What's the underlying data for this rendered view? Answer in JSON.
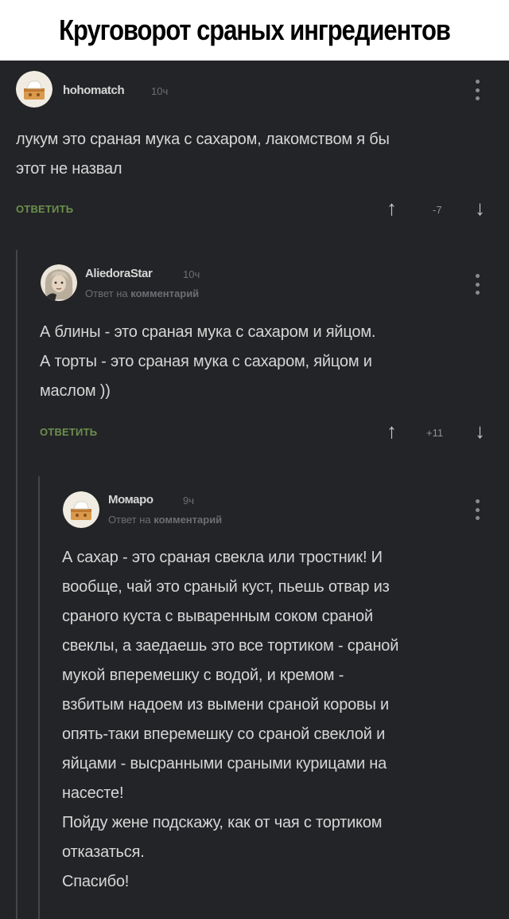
{
  "banner": {
    "title": "Круговорот сраных ингредиентов"
  },
  "comments": [
    {
      "username": "hohomatch",
      "time": "10ч",
      "lines": [
        "лукум это сраная мука с сахаром, лакомством я бы",
        "этот не назвал"
      ],
      "reply_label": "ОТВЕТИТЬ",
      "score": "-7"
    },
    {
      "username": "AliedoraStar",
      "time": "10ч",
      "reply_prefix": "Ответ на",
      "reply_target": "комментарий",
      "lines": [
        "А блины - это сраная мука с сахаром и яйцом.",
        "А торты - это сраная мука с сахаром, яйцом и",
        "маслом ))"
      ],
      "reply_label": "ОТВЕТИТЬ",
      "score": "+11"
    },
    {
      "username": "Момаро",
      "time": "9ч",
      "reply_prefix": "Ответ на",
      "reply_target": "комментарий",
      "lines": [
        "А сахар - это сраная свекла или тростник! И",
        "вообще, чай это сраный куст, пьешь отвар из",
        "сраного куста с вываренным соком сраной",
        "свеклы, а заедаешь это все тортиком - сраной",
        "мукой вперемешку с водой, и кремом -",
        "взбитым надоем из вымени сраной коровы и",
        "опять-таки вперемешку со сраной свеклой и",
        "яйцами - высранными сраными курицами на",
        "насесте!",
        "Пойду жене подскажу, как от чая с тортиком",
        "отказаться.",
        "Спасибо!"
      ]
    }
  ],
  "icons": {
    "upvote": "↑",
    "downvote": "↓"
  },
  "colors": {
    "background": "#232427",
    "reply_green": "#6b8f4e",
    "text": "#d6d6d6",
    "muted": "#6c6e73"
  }
}
